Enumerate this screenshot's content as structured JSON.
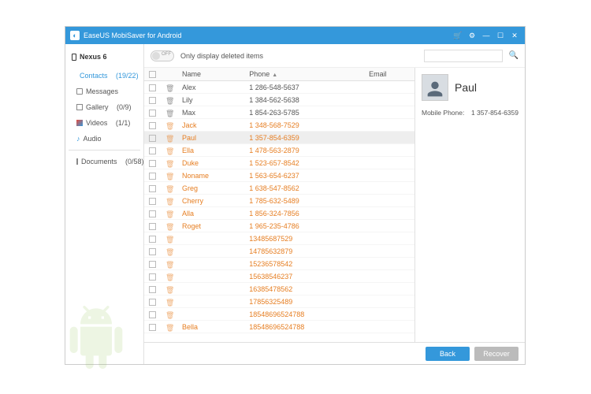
{
  "titlebar": {
    "title": "EaseUS MobiSaver for Android"
  },
  "sidebar": {
    "device": "Nexus 6",
    "items": [
      {
        "label": "Contacts",
        "count": "(19/22)",
        "active": true
      },
      {
        "label": "Messages",
        "count": ""
      },
      {
        "label": "Gallery",
        "count": "(0/9)"
      },
      {
        "label": "Videos",
        "count": "(1/1)"
      },
      {
        "label": "Audio",
        "count": ""
      }
    ],
    "documents": {
      "label": "Documents",
      "count": "(0/58)"
    }
  },
  "toolbar": {
    "toggle_label": "Only display deleted items",
    "search_placeholder": ""
  },
  "columns": {
    "name": "Name",
    "phone": "Phone",
    "email": "Email"
  },
  "rows": [
    {
      "name": "Alex",
      "phone": "1 286-548-5637",
      "deleted": false,
      "selected": false
    },
    {
      "name": "Lily",
      "phone": "1 384-562-5638",
      "deleted": false,
      "selected": false
    },
    {
      "name": "Max",
      "phone": "1 854-263-5785",
      "deleted": false,
      "selected": false
    },
    {
      "name": "Jack",
      "phone": "1 348-568-7529",
      "deleted": true,
      "selected": false
    },
    {
      "name": "Paul",
      "phone": "1 357-854-6359",
      "deleted": true,
      "selected": true
    },
    {
      "name": "Ella",
      "phone": "1 478-563-2879",
      "deleted": true,
      "selected": false
    },
    {
      "name": "Duke",
      "phone": "1 523-657-8542",
      "deleted": true,
      "selected": false
    },
    {
      "name": "Noname",
      "phone": "1 563-654-6237",
      "deleted": true,
      "selected": false
    },
    {
      "name": "Greg",
      "phone": "1 638-547-8562",
      "deleted": true,
      "selected": false
    },
    {
      "name": "Cherry",
      "phone": "1 785-632-5489",
      "deleted": true,
      "selected": false
    },
    {
      "name": "Alla",
      "phone": "1 856-324-7856",
      "deleted": true,
      "selected": false
    },
    {
      "name": "Roget",
      "phone": "1 965-235-4786",
      "deleted": true,
      "selected": false
    },
    {
      "name": "",
      "phone": "13485687529",
      "deleted": true,
      "selected": false
    },
    {
      "name": "",
      "phone": "14785632879",
      "deleted": true,
      "selected": false
    },
    {
      "name": "",
      "phone": "15236578542",
      "deleted": true,
      "selected": false
    },
    {
      "name": "",
      "phone": "15638546237",
      "deleted": true,
      "selected": false
    },
    {
      "name": "",
      "phone": "16385478562",
      "deleted": true,
      "selected": false
    },
    {
      "name": "",
      "phone": "17856325489",
      "deleted": true,
      "selected": false
    },
    {
      "name": "",
      "phone": "18548696524788",
      "deleted": true,
      "selected": false
    },
    {
      "name": "Bella",
      "phone": "18548696524788",
      "deleted": true,
      "selected": false
    }
  ],
  "detail": {
    "name": "Paul",
    "phone_label": "Mobile Phone:",
    "phone_value": "1 357-854-6359"
  },
  "footer": {
    "back": "Back",
    "recover": "Recover"
  }
}
